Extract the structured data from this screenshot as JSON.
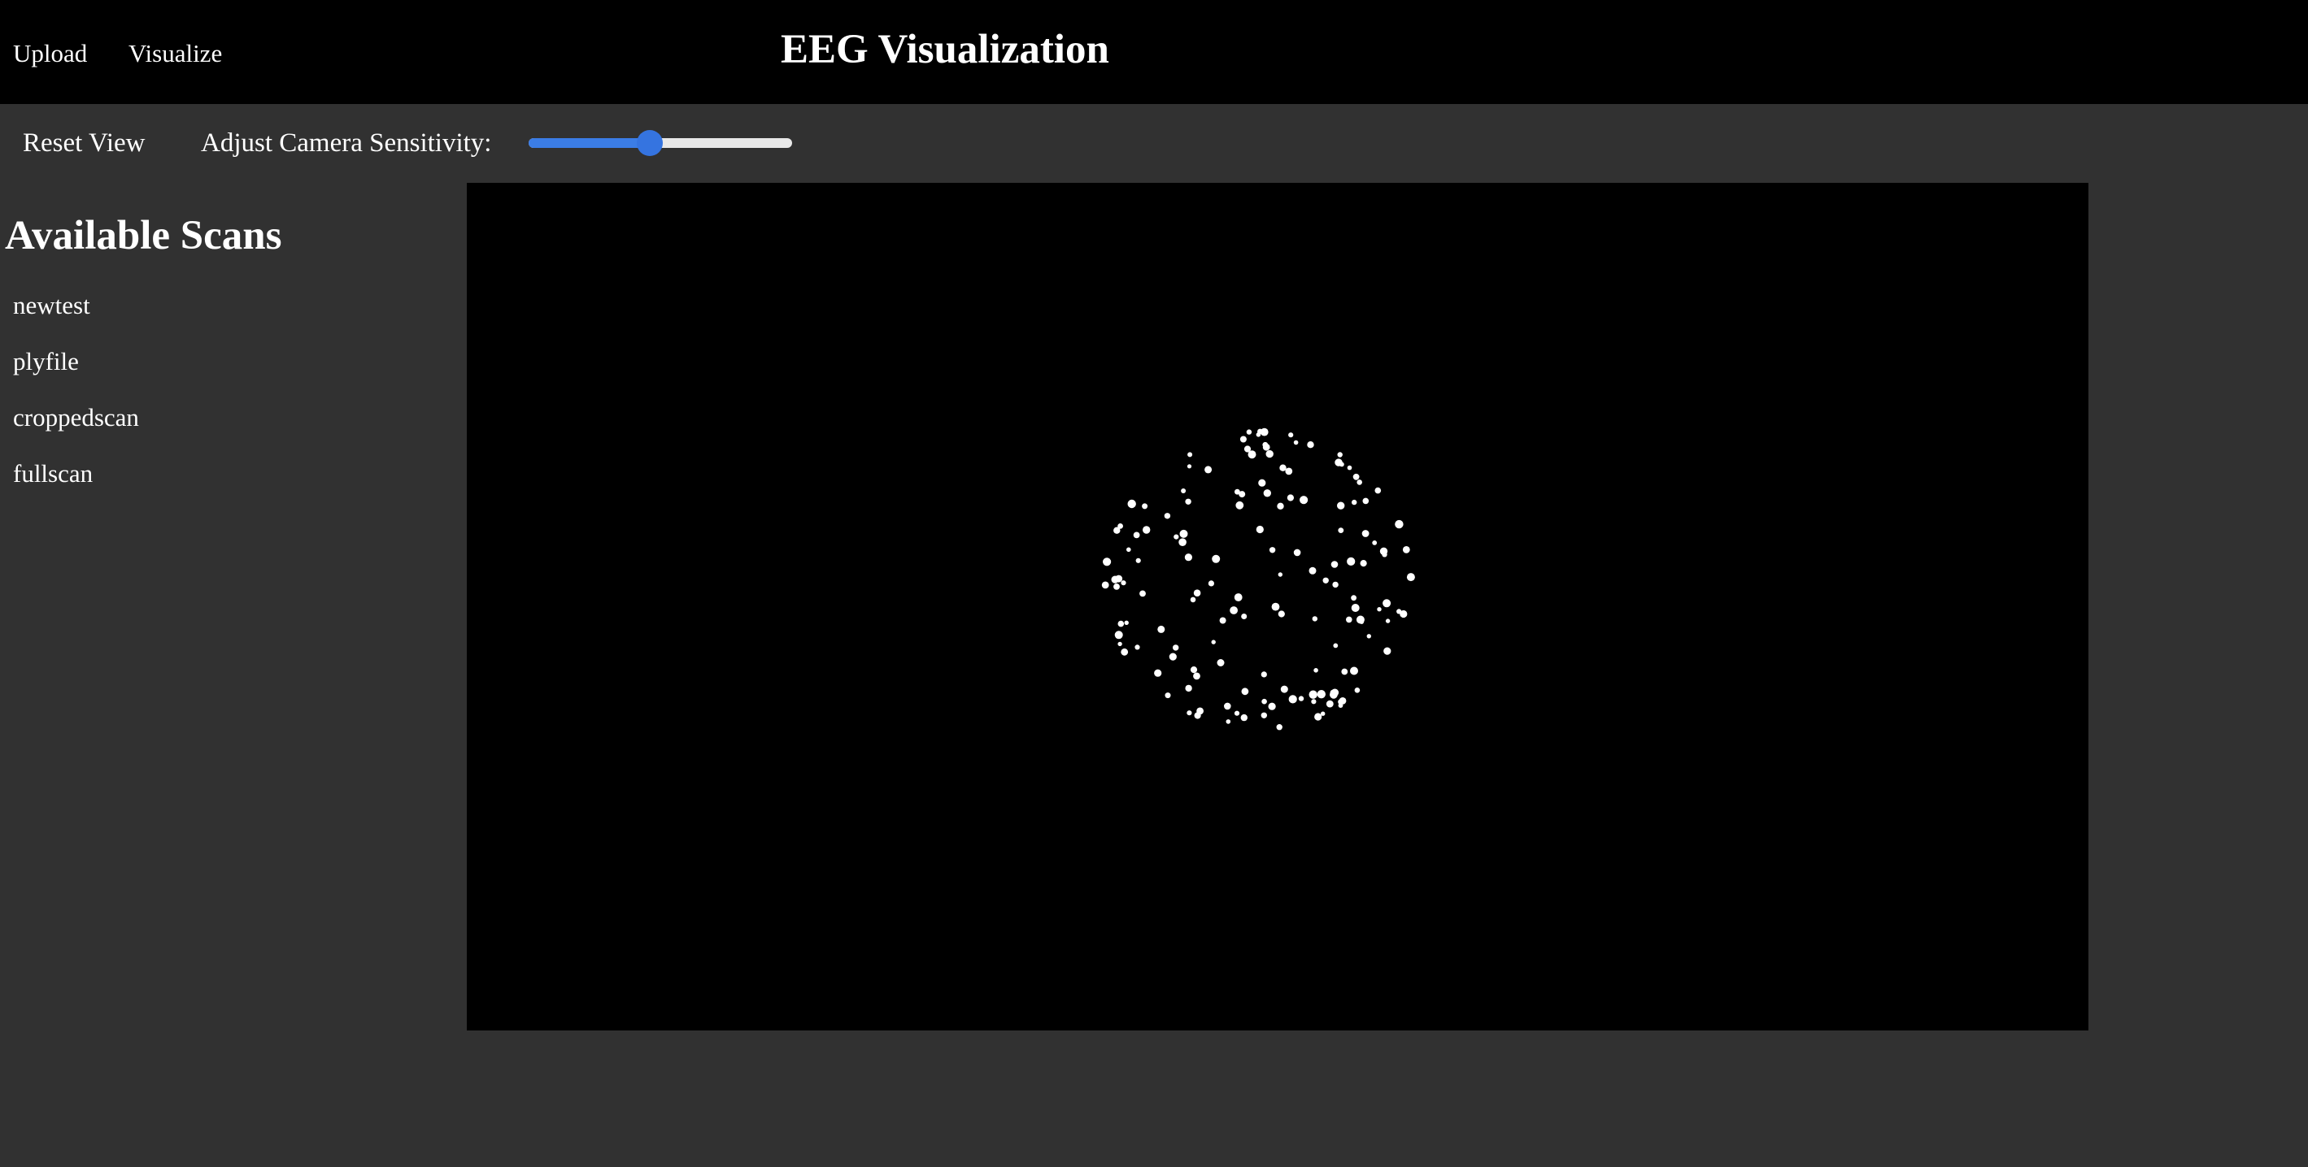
{
  "nav": {
    "upload_label": "Upload",
    "visualize_label": "Visualize"
  },
  "app": {
    "title": "EEG Visualization"
  },
  "controls": {
    "reset_label": "Reset View",
    "sensitivity_label": "Adjust Camera Sensitivity:",
    "sensitivity_value": 0.46
  },
  "sidebar": {
    "title": "Available Scans",
    "scans": [
      "newtest",
      "plyfile",
      "croppedscan",
      "fullscan"
    ]
  },
  "colors": {
    "accent": "#3b7de6",
    "page_background": "#313131",
    "bar_background": "#000000",
    "point_color": "#ffffff"
  },
  "viewer": {
    "content": "point-cloud"
  }
}
